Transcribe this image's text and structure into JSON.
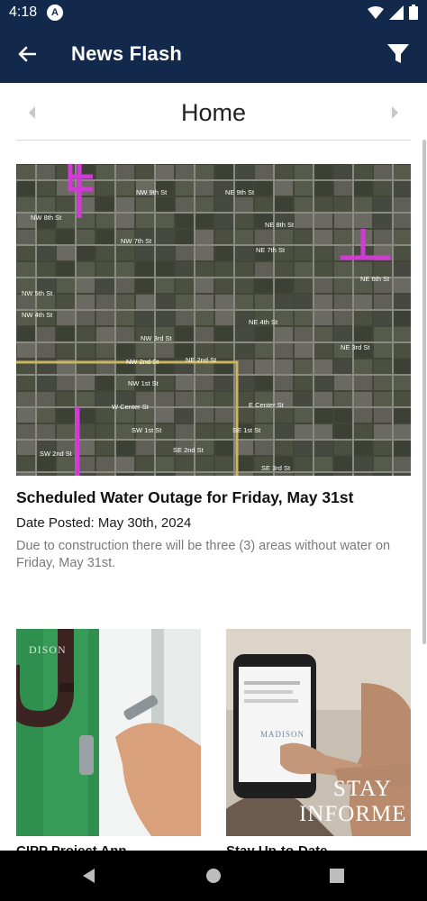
{
  "status_bar": {
    "time": "4:18",
    "app_icon_glyph": "A"
  },
  "app_bar": {
    "title": "News Flash",
    "back_icon": "arrow-left-icon",
    "filter_icon": "filter-icon"
  },
  "category": {
    "title": "Home"
  },
  "news": {
    "title": "Scheduled Water Outage for Friday, May 31st",
    "date": "Date Posted: May 30th, 2024",
    "description": "Due to construction there will be three (3) areas without water on Friday, May 31st."
  },
  "thumbnails": [
    {
      "caption": "CIPP Project Ann"
    },
    {
      "caption": "Stay Up-to-Date",
      "overlay_line1": "STAY",
      "overlay_line2": "INFORME",
      "brand": "MADISON"
    }
  ],
  "map": {
    "street_labels": [
      "NW 9th St",
      "NE 9th St",
      "NW 8th St",
      "NE 8th St",
      "NW 7th St",
      "NE 7th St",
      "NE 6th St",
      "NW 5th St",
      "NW 4th St",
      "NE 4th St",
      "NW 3rd St",
      "NE 3rd St",
      "NW 2nd St",
      "NE 2nd St",
      "NW 1st St",
      "W Center St",
      "E Center St",
      "SW 1st St",
      "SE 1st St",
      "SW 2nd St",
      "SE 2nd St",
      "SE 3rd St"
    ],
    "outage_color": "#d23ad6",
    "road_color": "#c9b660"
  },
  "colors": {
    "primary": "#13294b"
  }
}
